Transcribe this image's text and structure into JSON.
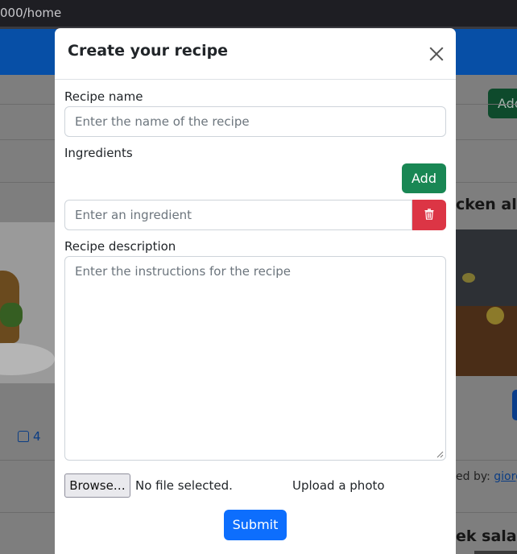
{
  "browser": {
    "url": "000/home"
  },
  "background": {
    "add_button_label": "Add",
    "likes_count": "4",
    "card_title": "cken ala",
    "posted_by_label": "ed by:",
    "posted_by_user": "giorg",
    "card_title_2": "ek salad"
  },
  "modal": {
    "title": "Create your recipe",
    "recipe_name_label": "Recipe name",
    "recipe_name_placeholder": "Enter the name of the recipe",
    "ingredients_label": "Ingredients",
    "add_label": "Add",
    "ingredient_placeholder": "Enter an ingredient",
    "description_label": "Recipe description",
    "description_placeholder": "Enter the instructions for the recipe",
    "browse_label": "Browse…",
    "no_file_text": "No file selected.",
    "upload_label": "Upload a photo",
    "submit_label": "Submit"
  },
  "colors": {
    "primary": "#0d6efd",
    "success": "#198754",
    "danger": "#dc3545"
  }
}
